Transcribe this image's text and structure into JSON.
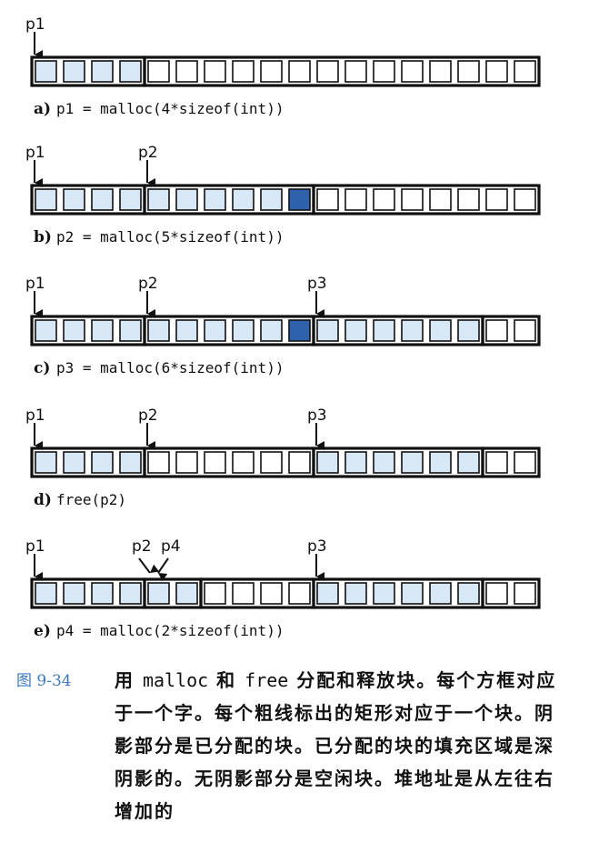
{
  "panels": [
    {
      "letter": "a)",
      "code": "p1 = malloc(4*sizeof(int))",
      "cells": [
        "a",
        "a",
        "a",
        "a",
        "f",
        "f",
        "f",
        "f",
        "f",
        "f",
        "f",
        "f",
        "f",
        "f",
        "f",
        "f",
        "f",
        "f"
      ],
      "thick_at": [
        0,
        4,
        18
      ],
      "pointers": [
        {
          "label": "p1",
          "cell": 0
        }
      ]
    },
    {
      "letter": "b)",
      "code": "p2 = malloc(5*sizeof(int))",
      "cells": [
        "a",
        "a",
        "a",
        "a",
        "a",
        "a",
        "a",
        "a",
        "a",
        "p",
        "f",
        "f",
        "f",
        "f",
        "f",
        "f",
        "f",
        "f"
      ],
      "thick_at": [
        0,
        4,
        10,
        18
      ],
      "pointers": [
        {
          "label": "p1",
          "cell": 0
        },
        {
          "label": "p2",
          "cell": 4
        }
      ]
    },
    {
      "letter": "c)",
      "code": "p3 = malloc(6*sizeof(int))",
      "cells": [
        "a",
        "a",
        "a",
        "a",
        "a",
        "a",
        "a",
        "a",
        "a",
        "p",
        "a",
        "a",
        "a",
        "a",
        "a",
        "a",
        "f",
        "f"
      ],
      "thick_at": [
        0,
        4,
        10,
        16,
        18
      ],
      "pointers": [
        {
          "label": "p1",
          "cell": 0
        },
        {
          "label": "p2",
          "cell": 4
        },
        {
          "label": "p3",
          "cell": 10
        }
      ]
    },
    {
      "letter": "d)",
      "code": "free(p2)",
      "cells": [
        "a",
        "a",
        "a",
        "a",
        "f",
        "f",
        "f",
        "f",
        "f",
        "f",
        "a",
        "a",
        "a",
        "a",
        "a",
        "a",
        "f",
        "f"
      ],
      "thick_at": [
        0,
        4,
        10,
        16,
        18
      ],
      "pointers": [
        {
          "label": "p1",
          "cell": 0
        },
        {
          "label": "p2",
          "cell": 4
        },
        {
          "label": "p3",
          "cell": 10
        }
      ]
    },
    {
      "letter": "e)",
      "code": "p4 = malloc(2*sizeof(int))",
      "cells": [
        "a",
        "a",
        "a",
        "a",
        "a",
        "a",
        "f",
        "f",
        "f",
        "f",
        "a",
        "a",
        "a",
        "a",
        "a",
        "a",
        "f",
        "f"
      ],
      "thick_at": [
        0,
        4,
        6,
        10,
        16,
        18
      ],
      "pointers": [
        {
          "label": "p1",
          "cell": 0
        },
        {
          "label": "p2",
          "cell": 4,
          "diagonal": "right"
        },
        {
          "label": "p4",
          "cell": 4,
          "diagonal": "left"
        },
        {
          "label": "p3",
          "cell": 10
        }
      ]
    }
  ],
  "colors": {
    "allocated": "#d8e8f6",
    "padding": "#2f62ad",
    "free": "#ffffff",
    "line": "#111111",
    "figure_number": "#3a78c0"
  },
  "caption": {
    "figure_number": "图 9-34",
    "parts": [
      {
        "text": "用 ",
        "mono": false
      },
      {
        "text": "malloc",
        "mono": true
      },
      {
        "text": " 和 ",
        "mono": false
      },
      {
        "text": "free",
        "mono": true
      },
      {
        "text": " 分配和释放块。每个方框对应于一个字。每个粗线标出的矩形对应于一个块。阴影部分是已分配的块。已分配的块的填充区域是深阴影的。无阴影部分是空闲块。堆地址是从左往右增加的",
        "mono": false
      }
    ]
  }
}
